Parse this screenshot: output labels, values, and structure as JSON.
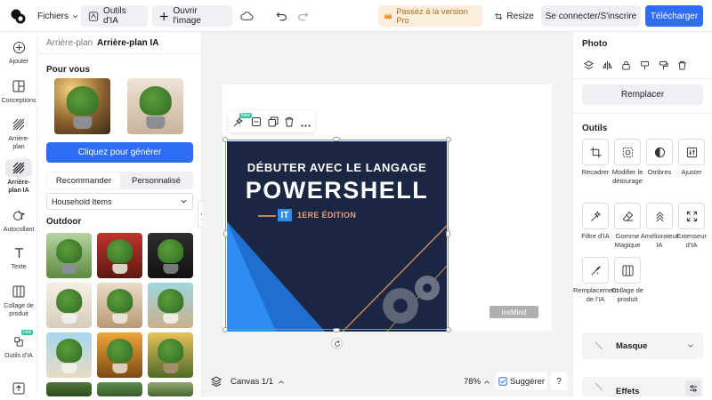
{
  "topbar": {
    "files_label": "Fichiers",
    "ai_tools_label": "Outils d'IA",
    "open_image_label": "Ouvrir l'image",
    "pro_label": "Passez à la version Pro",
    "resize_label": "Resize",
    "login_label": "Se connecter/S'inscrire",
    "download_label": "Télécharger"
  },
  "nav": [
    {
      "label": "Ajouter",
      "icon": "plus-circle-icon"
    },
    {
      "label": "Conceptions",
      "icon": "templates-icon"
    },
    {
      "label": "Arrière-plan",
      "icon": "background-icon"
    },
    {
      "label": "Arrière-plan IA",
      "icon": "ai-background-icon"
    },
    {
      "label": "Autocollant",
      "icon": "sticker-icon"
    },
    {
      "label": "Texte",
      "icon": "text-icon"
    },
    {
      "label": "Collage de produit",
      "icon": "collage-icon"
    },
    {
      "label": "Outils d'IA",
      "icon": "ai-tools-icon",
      "badge": "new"
    },
    {
      "label": "",
      "icon": "upload-icon"
    }
  ],
  "panel": {
    "tabs": [
      "Arrière-plan",
      "Arrière-plan IA"
    ],
    "for_you_title": "Pour vous",
    "generate_label": "Cliquez pour générer",
    "subtabs": [
      "Recommander",
      "Personnalisé"
    ],
    "category": "Household Items",
    "outdoor_title": "Outdoor"
  },
  "canvas": {
    "book_line1": "DÉBUTER AVEC LE LANGAGE",
    "book_line2": "POWERSHELL",
    "book_badge": "IT",
    "book_edition": "1ERE ÉDITION",
    "watermark": "insMind",
    "float_badge": "New"
  },
  "bottombar": {
    "canvas_label": "Canvas 1/1",
    "zoom": "78%",
    "suggest_label": "Suggérer",
    "help": "?"
  },
  "right": {
    "photo_title": "Photo",
    "replace_label": "Remplacer",
    "tools_title": "Outils",
    "tools": [
      {
        "label": "Recadrer",
        "icon": "crop-icon"
      },
      {
        "label": "Modifier le détourage",
        "icon": "cutout-edit-icon"
      },
      {
        "label": "Ombres",
        "icon": "shadow-icon"
      },
      {
        "label": "Ajuster",
        "icon": "adjust-icon"
      },
      {
        "label": "Filtre d'IA",
        "icon": "ai-filter-icon"
      },
      {
        "label": "Gomme Magique",
        "icon": "eraser-icon"
      },
      {
        "label": "Améliorateur IA",
        "icon": "enhancer-icon"
      },
      {
        "label": "Extenseur d'IA",
        "icon": "expand-icon"
      },
      {
        "label": "Remplacement de l'IA",
        "icon": "replace-ai-icon"
      },
      {
        "label": "Collage de produit",
        "icon": "collage-icon"
      }
    ],
    "mask_label": "Masque",
    "effects_label": "Effets"
  },
  "colors": {
    "primary": "#2f6df6",
    "pro_bg": "#fbeedd",
    "pro_text": "#b06a1a",
    "book_bg": "#1a2642",
    "book_blue": "#2e8bf0"
  }
}
